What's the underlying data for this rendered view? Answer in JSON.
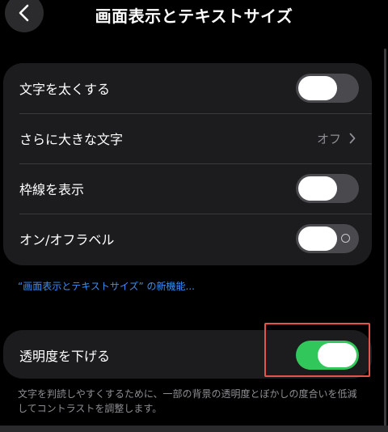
{
  "header": {
    "title": "画面表示とテキストサイズ",
    "back_icon": "chevron-left-icon"
  },
  "group1": {
    "rows": [
      {
        "label": "文字を太くする",
        "type": "toggle",
        "on": false
      },
      {
        "label": "さらに大きな文字",
        "type": "link",
        "value": "オフ"
      },
      {
        "label": "枠線を表示",
        "type": "toggle",
        "on": false
      },
      {
        "label": "オン/オフラベル",
        "type": "toggle",
        "on": false
      }
    ]
  },
  "new_features_link": "“画面表示とテキストサイズ” の新機能...",
  "group2": {
    "rows": [
      {
        "label": "透明度を下げる",
        "type": "toggle",
        "on": true
      }
    ]
  },
  "footer": {
    "description": "文字を判読しやすくするために、一部の背景の透明度とぼかしの度合いを低減してコントラストを調整します。"
  },
  "colors": {
    "background": "#000000",
    "group_background": "#1c1c1e",
    "toggle_off": "#4a4a4e",
    "toggle_on": "#32c75a",
    "link": "#3b8ef3",
    "secondary_text": "#8e8e93",
    "highlight": "#e5544a"
  }
}
